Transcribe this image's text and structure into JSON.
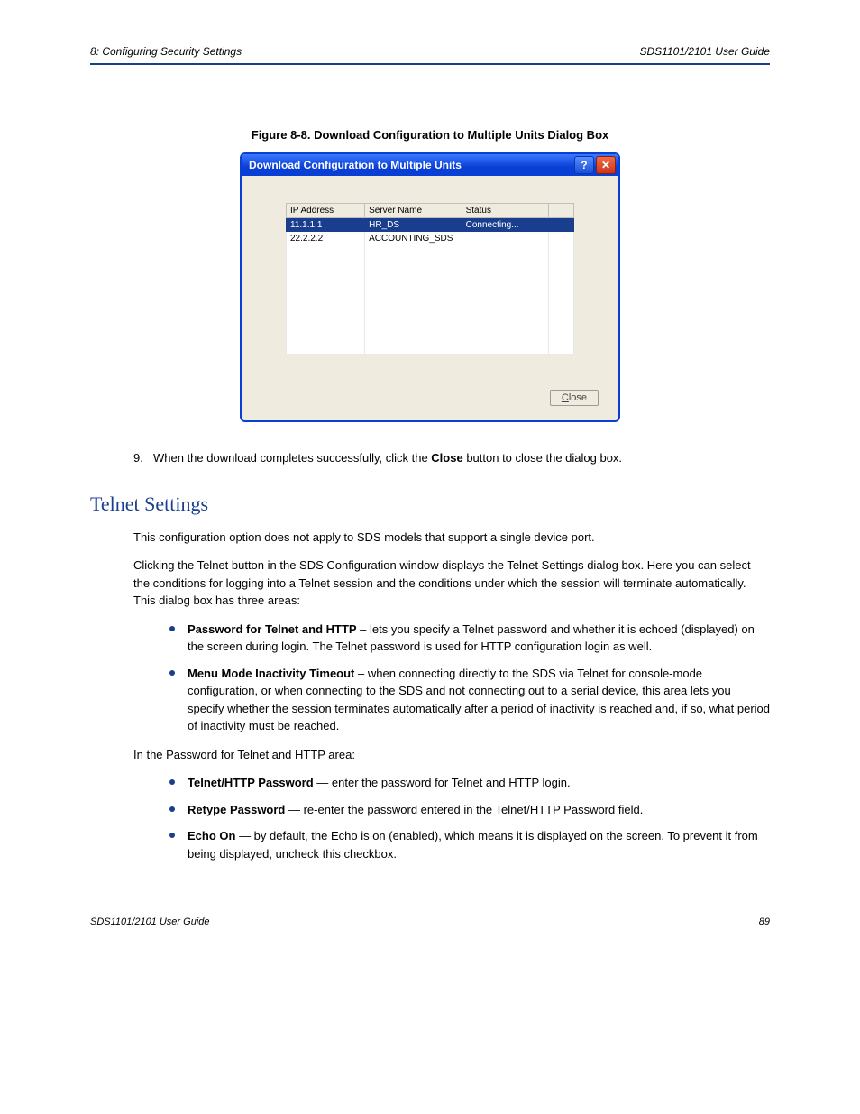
{
  "header": {
    "left": "8: Configuring Security Settings",
    "right": "SDS1101/2101 User Guide"
  },
  "figure": {
    "caption": "Figure 8-8. Download Configuration to Multiple Units Dialog Box"
  },
  "dialog": {
    "title": "Download Configuration to Multiple Units",
    "help_glyph": "?",
    "close_glyph": "✕",
    "columns": {
      "ip": "IP Address",
      "server": "Server Name",
      "status": "Status",
      "blank": ""
    },
    "rows": [
      {
        "ip": "11.1.1.1",
        "server": "HR_DS",
        "status": "Connecting..."
      },
      {
        "ip": "22.2.2.2",
        "server": "ACCOUNTING_SDS",
        "status": ""
      }
    ],
    "close_btn_pre": "C",
    "close_btn_rest": "lose"
  },
  "steps": {
    "s9_num": "9.",
    "s9_text_a": "When the download completes successfully, click the ",
    "s9_bold": "Close",
    "s9_text_b": " button to close the dialog box."
  },
  "section": {
    "title": "Telnet Settings"
  },
  "intro": {
    "p1": "This configuration option does not apply to SDS models that support a single device port.",
    "p2": "Clicking the Telnet button in the SDS Configuration window displays the Telnet Settings dialog box. Here you can select the conditions for logging into a Telnet session and the conditions under which the session will terminate automatically. This dialog box has three areas:"
  },
  "bullets_intro": {
    "b1_bold": "Password for Telnet and HTTP",
    "b1_rest": " – lets you specify a Telnet password and whether it is echoed (displayed) on the screen during login. The Telnet password is used for HTTP configuration login as well.",
    "b2_bold": "Menu Mode Inactivity Timeout",
    "b2_rest": " – when connecting directly to the SDS via Telnet for console-mode configuration, or when connecting to the SDS and not connecting out to a serial device, this area lets you specify whether the session terminates automatically after a period of inactivity is reached and, if so, what period of inactivity must be reached."
  },
  "telnet_area": {
    "lead": "In the Password for Telnet and HTTP area:",
    "b1_bold": "Telnet/HTTP Password",
    "b1_rest": " — enter the password for Telnet and HTTP login.",
    "b2_bold": "Retype Password",
    "b2_rest": " — re-enter the password entered in the Telnet/HTTP Password field.",
    "b3_bold": "Echo On",
    "b3_rest": " — by default, the Echo is on (enabled), which means it is displayed on the screen. To prevent it from being displayed, uncheck this checkbox."
  },
  "footer": {
    "left": "SDS1101/2101 User Guide",
    "right": "89"
  }
}
